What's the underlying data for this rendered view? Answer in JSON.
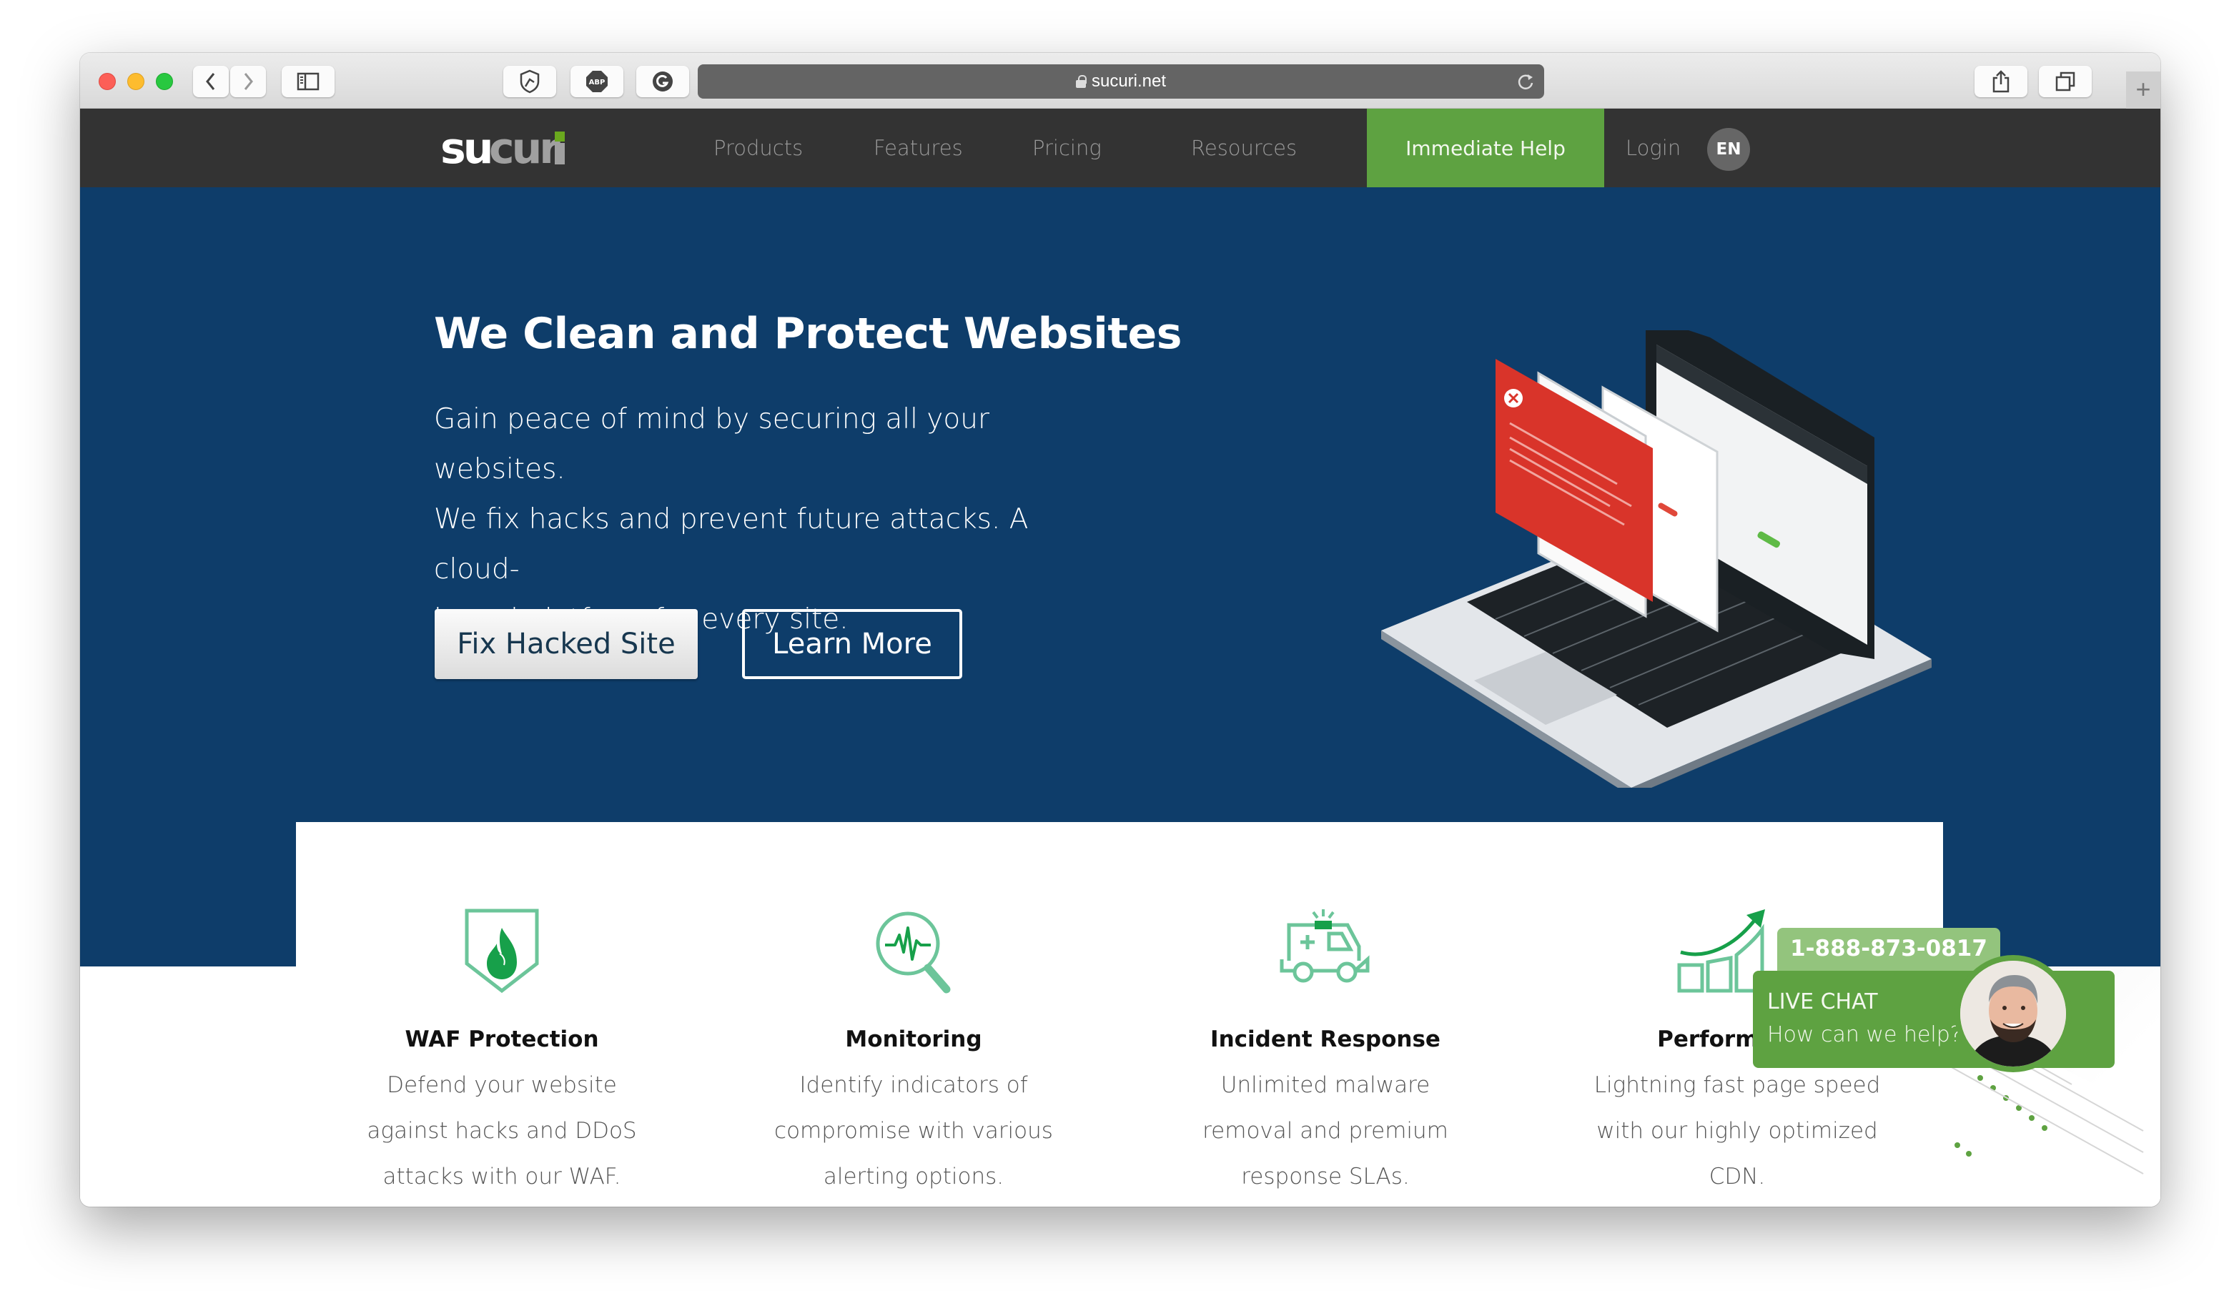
{
  "browser": {
    "url": "sucuri.net",
    "buttons": {
      "back": "back",
      "forward": "forward",
      "sidebar": "sidebar",
      "extension_1": "shield-extension",
      "extension_2": "ABP",
      "extension_3": "G",
      "share": "share",
      "tabs": "tabs",
      "new_tab": "+"
    }
  },
  "nav": {
    "logo": "sucuri",
    "links": [
      "Products",
      "Features",
      "Pricing",
      "Resources"
    ],
    "cta": "Immediate Help",
    "login": "Login",
    "language": "EN"
  },
  "hero": {
    "title": "We Clean and Protect Websites",
    "text_lines": [
      "Gain peace of mind by securing all your websites.",
      "We fix hacks and prevent future attacks. A cloud-",
      "based platform for every site."
    ],
    "primary_button": "Fix Hacked Site",
    "secondary_button": "Learn More",
    "illustration": "laptop-with-security-dashboard"
  },
  "features": [
    {
      "icon": "shield-fire-icon",
      "title": "WAF Protection",
      "desc_lines": [
        "Defend your website",
        "against hacks and DDoS",
        "attacks with our WAF."
      ]
    },
    {
      "icon": "magnifier-pulse-icon",
      "title": "Monitoring",
      "desc_lines": [
        "Identify indicators of",
        "compromise with various",
        "alerting options."
      ]
    },
    {
      "icon": "ambulance-icon",
      "title": "Incident Response",
      "desc_lines": [
        "Unlimited malware",
        "removal and premium",
        "response SLAs."
      ]
    },
    {
      "icon": "growth-chart-icon",
      "title": "Performance",
      "desc_lines": [
        "Lightning fast page speed",
        "with our highly optimized",
        "CDN."
      ]
    }
  ],
  "chat": {
    "phone": "1-888-873-0817",
    "title": "LIVE CHAT",
    "subtitle": "How can we help?"
  },
  "colors": {
    "nav_bg": "#333333",
    "hero_bg": "#0e3d6a",
    "accent_green": "#5ea241",
    "light_green": "#93c47d",
    "icon_green": "#6cc59a",
    "icon_dark_green": "#17a04a"
  }
}
